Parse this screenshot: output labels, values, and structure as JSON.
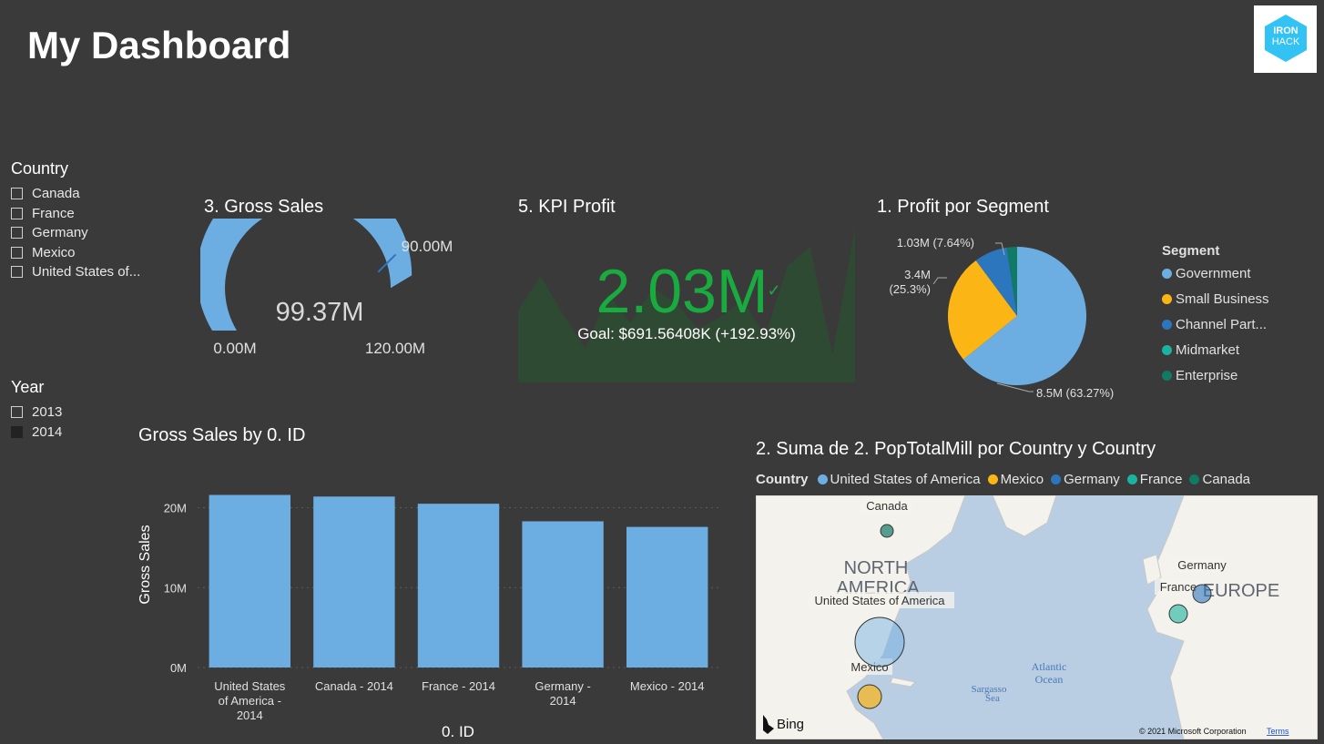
{
  "page": {
    "title": "My Dashboard"
  },
  "logo": {
    "line1": "IRON",
    "line2": "HACK"
  },
  "slicers": {
    "country": {
      "title": "Country",
      "items": [
        {
          "label": "Canada",
          "checked": false
        },
        {
          "label": "France",
          "checked": false
        },
        {
          "label": "Germany",
          "checked": false
        },
        {
          "label": "Mexico",
          "checked": false
        },
        {
          "label": "United States of...",
          "checked": false
        }
      ]
    },
    "year": {
      "title": "Year",
      "items": [
        {
          "label": "2013",
          "checked": false
        },
        {
          "label": "2014",
          "checked": true
        }
      ]
    }
  },
  "gauge": {
    "title": "3. Gross Sales",
    "value_label": "99.37M",
    "min_label": "0.00M",
    "max_label": "120.00M",
    "target_label": "90.00M",
    "value": 99.37,
    "min": 0,
    "max": 120,
    "target": 90,
    "fill_color": "#6daee2"
  },
  "kpi": {
    "title": "5. KPI Profit",
    "value_label": "2.03M",
    "check_mark": "✓",
    "goal_label": "Goal: $691.56408K (+192.93%)",
    "value_color": "#1aab40",
    "trend": [
      0.35,
      0.62,
      0.32,
      0.05,
      0.48,
      0.25,
      0.52,
      0.42,
      0.2,
      0.3,
      0.43,
      0.15,
      0.7,
      0.85,
      0.0,
      1.0
    ]
  },
  "pie": {
    "title": "1. Profit por Segment",
    "legend_title": "Segment",
    "labels": {
      "government": "8.5M (63.27%)",
      "small_business_1": "3.4M",
      "small_business_2": "(25.3%)",
      "channel": "1.03M (7.64%)"
    }
  },
  "map": {
    "title": "2. Suma de 2. PopTotalMill por Country y Country",
    "legend_title": "Country",
    "regions": {
      "na1": "NORTH",
      "na2": "AMERICA",
      "europe": "EUROPE",
      "atlantic1": "Atlantic",
      "atlantic2": "Ocean",
      "sargasso1": "Sargasso",
      "sargasso2": "Sea"
    },
    "bubble_labels": {
      "canada": "Canada",
      "usa": "United States of America",
      "mexico": "Mexico",
      "germany": "Germany",
      "france": "France"
    },
    "bing": "Bing",
    "copyright": "© 2021 Microsoft Corporation",
    "terms": "Terms"
  },
  "chart_data": [
    {
      "type": "bar",
      "title": "Gross Sales by 0. ID",
      "xlabel": "0. ID",
      "ylabel": "Gross Sales",
      "categories": [
        "United States of America - 2014",
        "Canada - 2014",
        "France - 2014",
        "Germany - 2014",
        "Mexico - 2014"
      ],
      "category_lines": [
        [
          "United States",
          "of America -",
          "2014"
        ],
        [
          "Canada - 2014"
        ],
        [
          "France - 2014"
        ],
        [
          "Germany -",
          "2014"
        ],
        [
          "Mexico - 2014"
        ]
      ],
      "values": [
        21.6,
        21.4,
        20.5,
        18.3,
        17.6
      ],
      "ylim": [
        0,
        22
      ],
      "yticks": [
        0,
        10,
        20
      ],
      "ytick_labels": [
        "0M",
        "10M",
        "20M"
      ],
      "color": "#6daee2",
      "grid": true
    },
    {
      "type": "pie",
      "title": "1. Profit por Segment",
      "legend_title": "Segment",
      "categories": [
        "Government",
        "Small Business",
        "Channel Partners",
        "Midmarket",
        "Enterprise"
      ],
      "legend_labels": [
        "Government",
        "Small Business",
        "Channel Part...",
        "Midmarket",
        "Enterprise"
      ],
      "values": [
        8.5,
        3.4,
        1.03,
        0.0,
        0.32
      ],
      "percent": [
        63.27,
        25.3,
        7.64,
        0.0,
        2.38
      ],
      "colors": [
        "#6daee2",
        "#fbb515",
        "#2b76bc",
        "#1ab39f",
        "#117a65"
      ]
    },
    {
      "type": "scatter",
      "title": "2. Suma de 2. PopTotalMill por Country y Country",
      "legend_title": "Country",
      "categories": [
        "United States of America",
        "Mexico",
        "Germany",
        "France",
        "Canada"
      ],
      "colors": [
        "#6daee2",
        "#fbb515",
        "#2b76bc",
        "#1ab39f",
        "#117a65"
      ]
    }
  ]
}
